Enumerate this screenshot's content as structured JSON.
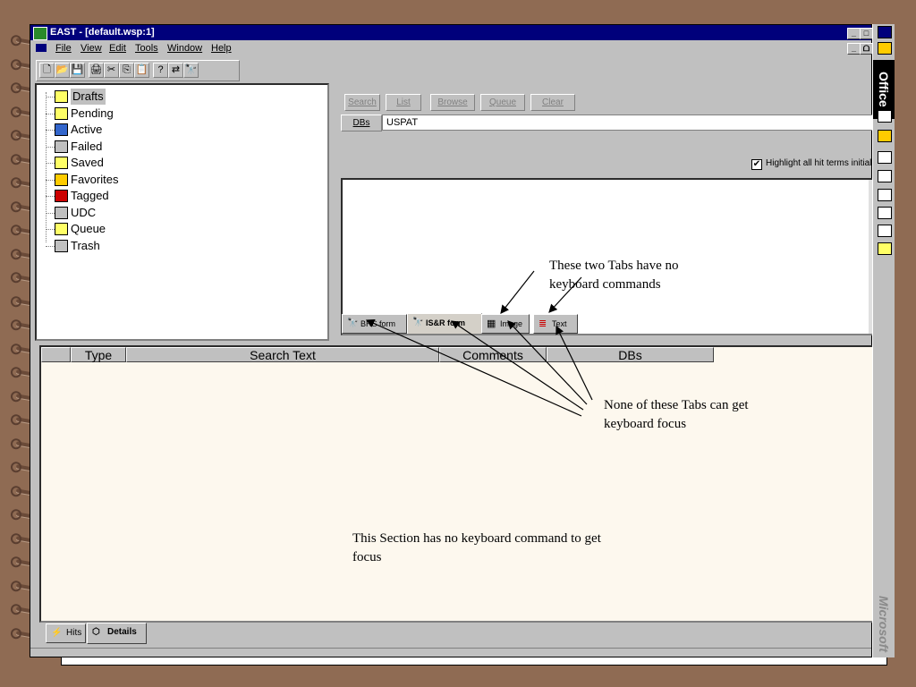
{
  "window": {
    "title": "EAST - [default.wsp:1]",
    "min_glyph": "_",
    "max_glyph": "□",
    "close_glyph": "×",
    "restore_glyph": "ᗝ"
  },
  "menu": [
    "File",
    "View",
    "Edit",
    "Tools",
    "Window",
    "Help"
  ],
  "toolbar": {
    "icons": [
      "new-icon",
      "open-icon",
      "save-icon",
      "print-icon",
      "cut-icon",
      "copy-icon",
      "paste-icon",
      "help-icon",
      "find-replace-icon",
      "binoculars-icon"
    ],
    "glyphs": [
      "🗋",
      "📂",
      "💾",
      "🖨",
      "✂",
      "⎘",
      "📋",
      "?",
      "⇄",
      "🔭"
    ]
  },
  "tree": {
    "items": [
      "Drafts",
      "Pending",
      "Active",
      "Failed",
      "Saved",
      "Favorites",
      "Tagged",
      "UDC",
      "Queue",
      "Trash"
    ],
    "colors": [
      "#ffff66",
      "#ffff66",
      "#3366cc",
      "#c0c0c0",
      "#ffff66",
      "#ffcc00",
      "#cc0000",
      "#c0c0c0",
      "#ffff66",
      "#c0c0c0"
    ]
  },
  "search_pane": {
    "buttons": [
      "Search",
      "List",
      "Browse",
      "Queue",
      "Clear"
    ],
    "dbs_label": "DBs",
    "dbs_value": "USPAT",
    "highlight_label": "Highlight all hit terms initial",
    "highlight_checked": "✔"
  },
  "tabs": [
    {
      "label": "BRS form",
      "icon": "binoculars-icon",
      "glyph": "🔭"
    },
    {
      "label": "IS&R form",
      "icon": "binoculars-icon",
      "glyph": "🔭"
    },
    {
      "label": "Image",
      "icon": "image-icon",
      "glyph": "▦"
    },
    {
      "label": "Text",
      "icon": "text-icon",
      "glyph": "≣"
    }
  ],
  "grid": {
    "columns": [
      "",
      "Type",
      "Search Text",
      "Comments",
      "DBs"
    ]
  },
  "bottom_tabs": [
    {
      "label": "Hits",
      "glyph": "⚡"
    },
    {
      "label": "Details",
      "glyph": "⬡"
    }
  ],
  "office_bar": {
    "title": "Office",
    "footer": "Microsoft"
  },
  "annotations": {
    "tabs_no_keyboard": "These two Tabs have no keyboard commands",
    "tabs_no_focus": "None of these Tabs can get keyboard focus",
    "section_no_focus": "This Section has no keyboard command to get focus"
  }
}
